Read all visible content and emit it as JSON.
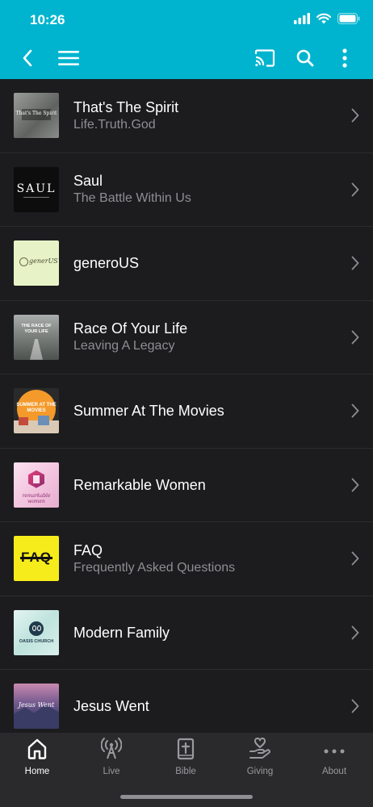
{
  "status": {
    "time": "10:26"
  },
  "nav": {
    "back_icon": "chevron-left-icon",
    "menu_icon": "hamburger-menu-icon",
    "cast_icon": "cast-icon",
    "search_icon": "search-icon",
    "more_icon": "more-vertical-icon"
  },
  "series": [
    {
      "title": "That's The Spirit",
      "subtitle": "Life.Truth.God",
      "thumb_text": "That's The Spirit",
      "thumb_bg": "#7c7f7c"
    },
    {
      "title": "Saul",
      "subtitle": "The Battle Within Us",
      "thumb_text": "SAUL",
      "thumb_bg": "#0d0d0d"
    },
    {
      "title": "generoUS",
      "subtitle": "",
      "thumb_text": "generUS",
      "thumb_bg": "#e7f3c6"
    },
    {
      "title": "Race Of Your Life",
      "subtitle": "Leaving A Legacy",
      "thumb_text": "THE RACE OF YOUR LIFE",
      "thumb_bg": "#6f7470"
    },
    {
      "title": "Summer At The Movies",
      "subtitle": "",
      "thumb_text": "SUMMER AT THE MOVIES",
      "thumb_bg": "#f39a2b"
    },
    {
      "title": "Remarkable Women",
      "subtitle": "",
      "thumb_text": "remarkable women",
      "thumb_bg": "#f7d5e8"
    },
    {
      "title": "FAQ",
      "subtitle": "Frequently Asked Questions",
      "thumb_text": "FAQ",
      "thumb_bg": "#f6ec1c"
    },
    {
      "title": "Modern Family",
      "subtitle": "",
      "thumb_text": "OASIS CHURCH",
      "thumb_bg": "#d6eeea"
    },
    {
      "title": "Jesus Went",
      "subtitle": "",
      "thumb_text": "Jesus Went",
      "thumb_bg": "#5a4f7a"
    }
  ],
  "tabs": [
    {
      "label": "Home",
      "icon": "home-icon",
      "active": true
    },
    {
      "label": "Live",
      "icon": "broadcast-icon",
      "active": false
    },
    {
      "label": "Bible",
      "icon": "bible-icon",
      "active": false
    },
    {
      "label": "Giving",
      "icon": "giving-hand-icon",
      "active": false
    },
    {
      "label": "About",
      "icon": "more-horizontal-icon",
      "active": false
    }
  ],
  "colors": {
    "accent": "#00b4cf",
    "background": "#1c1c1e",
    "tabbar": "#2a2a2c",
    "secondary_text": "#8e8e93"
  }
}
